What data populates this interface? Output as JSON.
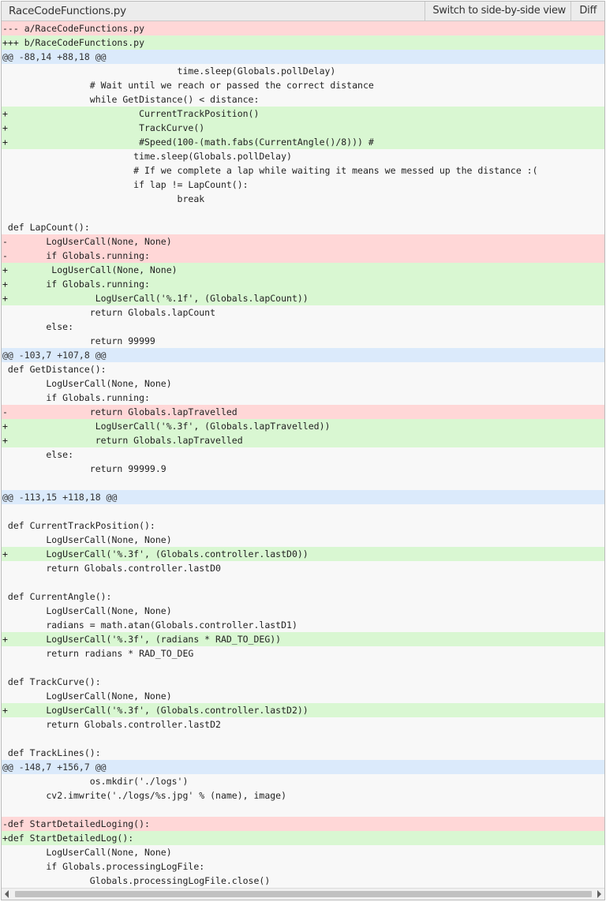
{
  "header": {
    "filename": "RaceCodeFunctions.py",
    "switch_label": "Switch to side-by-side view",
    "diff_label": "Diff"
  },
  "lines": [
    {
      "t": "meta-del",
      "s": "--- a/RaceCodeFunctions.py"
    },
    {
      "t": "meta-add",
      "s": "+++ b/RaceCodeFunctions.py"
    },
    {
      "t": "hunk",
      "s": "@@ -88,14 +88,18 @@"
    },
    {
      "t": "ctx",
      "s": "                                time.sleep(Globals.pollDelay)"
    },
    {
      "t": "ctx",
      "s": "                # Wait until we reach or passed the correct distance"
    },
    {
      "t": "ctx",
      "s": "                while GetDistance() < distance:"
    },
    {
      "t": "add",
      "s": "+                        CurrentTrackPosition()"
    },
    {
      "t": "add",
      "s": "+                        TrackCurve()"
    },
    {
      "t": "add",
      "s": "+                        #Speed(100-(math.fabs(CurrentAngle()/8))) #"
    },
    {
      "t": "ctx",
      "s": "                        time.sleep(Globals.pollDelay)"
    },
    {
      "t": "ctx",
      "s": "                        # If we complete a lap while waiting it means we messed up the distance :("
    },
    {
      "t": "ctx",
      "s": "                        if lap != LapCount():"
    },
    {
      "t": "ctx",
      "s": "                                break"
    },
    {
      "t": "ctx",
      "s": ""
    },
    {
      "t": "ctx",
      "s": " def LapCount():"
    },
    {
      "t": "del",
      "s": "-       LogUserCall(None, None)"
    },
    {
      "t": "del",
      "s": "-       if Globals.running:"
    },
    {
      "t": "add",
      "s": "+        LogUserCall(None, None)"
    },
    {
      "t": "add",
      "s": "+       if Globals.running:"
    },
    {
      "t": "add",
      "s": "+                LogUserCall('%.1f', (Globals.lapCount))"
    },
    {
      "t": "ctx",
      "s": "                return Globals.lapCount"
    },
    {
      "t": "ctx",
      "s": "        else:"
    },
    {
      "t": "ctx",
      "s": "                return 99999"
    },
    {
      "t": "hunk",
      "s": "@@ -103,7 +107,8 @@"
    },
    {
      "t": "ctx",
      "s": " def GetDistance():"
    },
    {
      "t": "ctx",
      "s": "        LogUserCall(None, None)"
    },
    {
      "t": "ctx",
      "s": "        if Globals.running:"
    },
    {
      "t": "del",
      "s": "-               return Globals.lapTravelled"
    },
    {
      "t": "add",
      "s": "+                LogUserCall('%.3f', (Globals.lapTravelled))"
    },
    {
      "t": "add",
      "s": "+                return Globals.lapTravelled"
    },
    {
      "t": "ctx",
      "s": "        else:"
    },
    {
      "t": "ctx",
      "s": "                return 99999.9"
    },
    {
      "t": "ctx",
      "s": ""
    },
    {
      "t": "hunk",
      "s": "@@ -113,15 +118,18 @@"
    },
    {
      "t": "ctx",
      "s": ""
    },
    {
      "t": "ctx",
      "s": " def CurrentTrackPosition():"
    },
    {
      "t": "ctx",
      "s": "        LogUserCall(None, None)"
    },
    {
      "t": "add",
      "s": "+       LogUserCall('%.3f', (Globals.controller.lastD0))"
    },
    {
      "t": "ctx",
      "s": "        return Globals.controller.lastD0"
    },
    {
      "t": "ctx",
      "s": ""
    },
    {
      "t": "ctx",
      "s": " def CurrentAngle():"
    },
    {
      "t": "ctx",
      "s": "        LogUserCall(None, None)"
    },
    {
      "t": "ctx",
      "s": "        radians = math.atan(Globals.controller.lastD1)"
    },
    {
      "t": "add",
      "s": "+       LogUserCall('%.3f', (radians * RAD_TO_DEG))"
    },
    {
      "t": "ctx",
      "s": "        return radians * RAD_TO_DEG"
    },
    {
      "t": "ctx",
      "s": ""
    },
    {
      "t": "ctx",
      "s": " def TrackCurve():"
    },
    {
      "t": "ctx",
      "s": "        LogUserCall(None, None)"
    },
    {
      "t": "add",
      "s": "+       LogUserCall('%.3f', (Globals.controller.lastD2))"
    },
    {
      "t": "ctx",
      "s": "        return Globals.controller.lastD2"
    },
    {
      "t": "ctx",
      "s": ""
    },
    {
      "t": "ctx",
      "s": " def TrackLines():"
    },
    {
      "t": "hunk",
      "s": "@@ -148,7 +156,7 @@"
    },
    {
      "t": "ctx",
      "s": "                os.mkdir('./logs')"
    },
    {
      "t": "ctx",
      "s": "        cv2.imwrite('./logs/%s.jpg' % (name), image)"
    },
    {
      "t": "ctx",
      "s": ""
    },
    {
      "t": "del",
      "s": "-def StartDetailedLoging():"
    },
    {
      "t": "add",
      "s": "+def StartDetailedLog():"
    },
    {
      "t": "ctx",
      "s": "        LogUserCall(None, None)"
    },
    {
      "t": "ctx",
      "s": "        if Globals.processingLogFile:"
    },
    {
      "t": "ctx",
      "s": "                Globals.processingLogFile.close()"
    }
  ],
  "scrollbar": {
    "left_icon": "arrow-left-icon",
    "right_icon": "arrow-right-icon"
  }
}
